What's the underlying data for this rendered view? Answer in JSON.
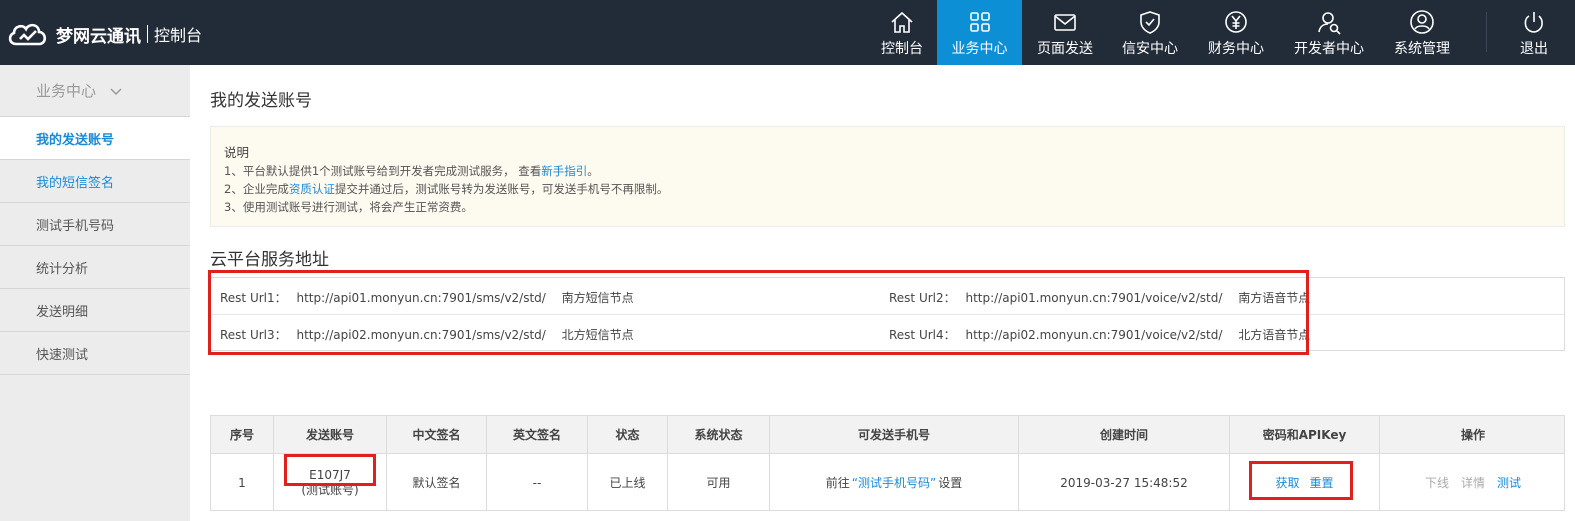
{
  "header": {
    "brand": "梦网云通讯",
    "console": "控制台",
    "nav": [
      {
        "label": "控制台",
        "icon": "home-icon"
      },
      {
        "label": "业务中心",
        "icon": "grid-icon"
      },
      {
        "label": "页面发送",
        "icon": "mail-icon"
      },
      {
        "label": "信安中心",
        "icon": "shield-icon"
      },
      {
        "label": "财务中心",
        "icon": "yuan-icon"
      },
      {
        "label": "开发者中心",
        "icon": "developer-icon"
      },
      {
        "label": "系统管理",
        "icon": "user-icon"
      }
    ],
    "logout": "退出"
  },
  "sidebar": {
    "title": "业务中心",
    "items": [
      {
        "label": "我的发送账号"
      },
      {
        "label": "我的短信签名"
      },
      {
        "label": "测试手机号码"
      },
      {
        "label": "统计分析"
      },
      {
        "label": "发送明细"
      },
      {
        "label": "快速测试"
      }
    ]
  },
  "main": {
    "title": "我的发送账号",
    "notice": {
      "title": "说明",
      "line1_pre": "1、平台默认提供1个测试账号给到开发者完成测试服务， 查看",
      "line1_link": "新手指引",
      "line1_post": "。",
      "line2_pre": "2、企业完成",
      "line2_link": "资质认证",
      "line2_post": "提交并通过后，测试账号转为发送账号，可发送手机号不再限制。",
      "line3": "3、使用测试账号进行测试，将会产生正常资费。"
    },
    "service_title": "云平台服务地址",
    "urls": [
      {
        "label": "Rest Url1：",
        "url": "http://api01.monyun.cn:7901/sms/v2/std/",
        "node": "南方短信节点"
      },
      {
        "label": "Rest Url2：",
        "url": "http://api01.monyun.cn:7901/voice/v2/std/",
        "node": "南方语音节点"
      },
      {
        "label": "Rest Url3：",
        "url": "http://api02.monyun.cn:7901/sms/v2/std/",
        "node": "北方短信节点"
      },
      {
        "label": "Rest Url4：",
        "url": "http://api02.monyun.cn:7901/voice/v2/std/",
        "node": "北方语音节点"
      }
    ],
    "table": {
      "headers": [
        "序号",
        "发送账号",
        "中文签名",
        "英文签名",
        "状态",
        "系统状态",
        "可发送手机号",
        "创建时间",
        "密码和APIKey",
        "操作"
      ],
      "row": {
        "index": "1",
        "account": "E107J7",
        "account_note": "(测试账号)",
        "cn_sign": "默认签名",
        "en_sign": "--",
        "status": "已上线",
        "sys_status": "可用",
        "phone_pre": "前往",
        "phone_link": "“测试手机号码”",
        "phone_post": "设置",
        "created": "2019-03-27 15:48:52",
        "key_get": "获取",
        "key_reset": "重置",
        "op_offline": "下线",
        "op_detail": "详情",
        "op_test": "测试"
      }
    }
  },
  "colors": {
    "header_bg": "#222b38",
    "accent": "#0d8fd6",
    "link": "#1a8ad6",
    "online": "#27a93b",
    "highlight_box": "#e0201c"
  }
}
